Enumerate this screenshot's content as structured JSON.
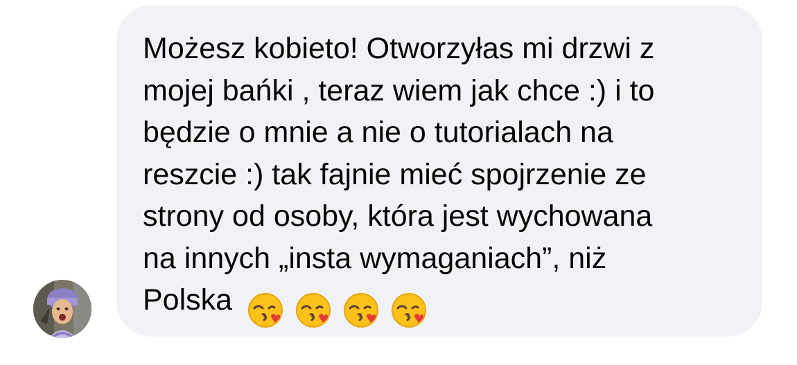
{
  "conversation": {
    "sender": {
      "avatar_icon": "user-avatar-photo"
    },
    "message": {
      "lines": [
        "Możesz kobieto! Otworzyłas mi drzwi z",
        "mojej bańki , teraz wiem jak chce :) i to",
        "będzie o mnie a nie o tutorialach na",
        "reszcie :) tak fajnie mieć spojrzenie ze",
        "strony od osoby, która jest wychowana",
        "na innych „insta wymaganiach”, niż",
        "Polska"
      ],
      "emojis": [
        "kissing-heart-emoji",
        "kissing-heart-emoji",
        "kissing-heart-emoji",
        "kissing-heart-emoji"
      ]
    },
    "colors": {
      "bubble_background": "#f1f2f5",
      "text": "#050505",
      "page_background": "#ffffff"
    }
  }
}
